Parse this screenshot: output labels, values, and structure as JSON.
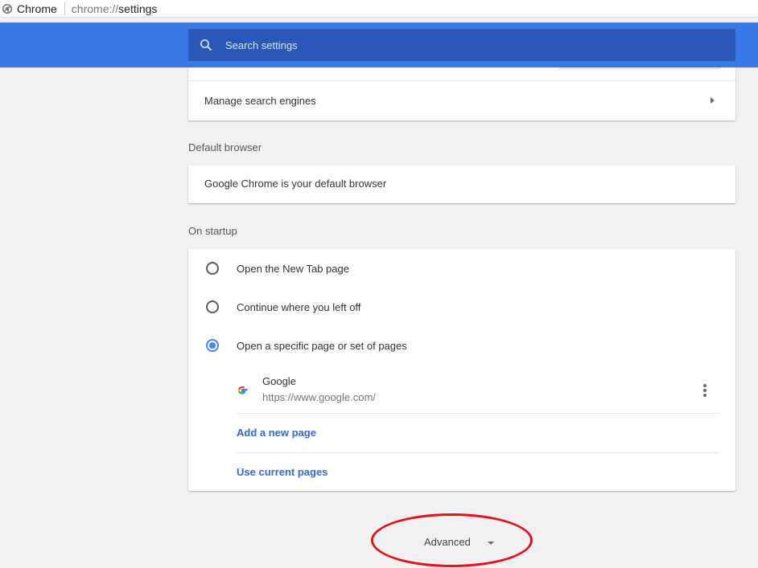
{
  "address_bar": {
    "chip_label": "Chrome",
    "url_scheme": "chrome://",
    "url_path": "settings"
  },
  "header": {
    "search_placeholder": "Search settings",
    "color": "#3b78e7"
  },
  "search_engine_section": {
    "manage_label": "Manage search engines"
  },
  "default_browser_section": {
    "title": "Default browser",
    "status_text": "Google Chrome is your default browser"
  },
  "startup_section": {
    "title": "On startup",
    "options": [
      {
        "label": "Open the New Tab page",
        "checked": false
      },
      {
        "label": "Continue where you left off",
        "checked": false
      },
      {
        "label": "Open a specific page or set of pages",
        "checked": true
      }
    ],
    "pages": [
      {
        "name": "Google",
        "url": "https://www.google.com/",
        "icon": "google-g-icon"
      }
    ],
    "add_page_link": "Add a new page",
    "use_current_link": "Use current pages"
  },
  "advanced": {
    "label": "Advanced",
    "highlight_color": "#e3111b"
  },
  "colors": {
    "link": "#3367d6",
    "radio_checked": "#4285f4",
    "background": "#f1f1f1"
  }
}
